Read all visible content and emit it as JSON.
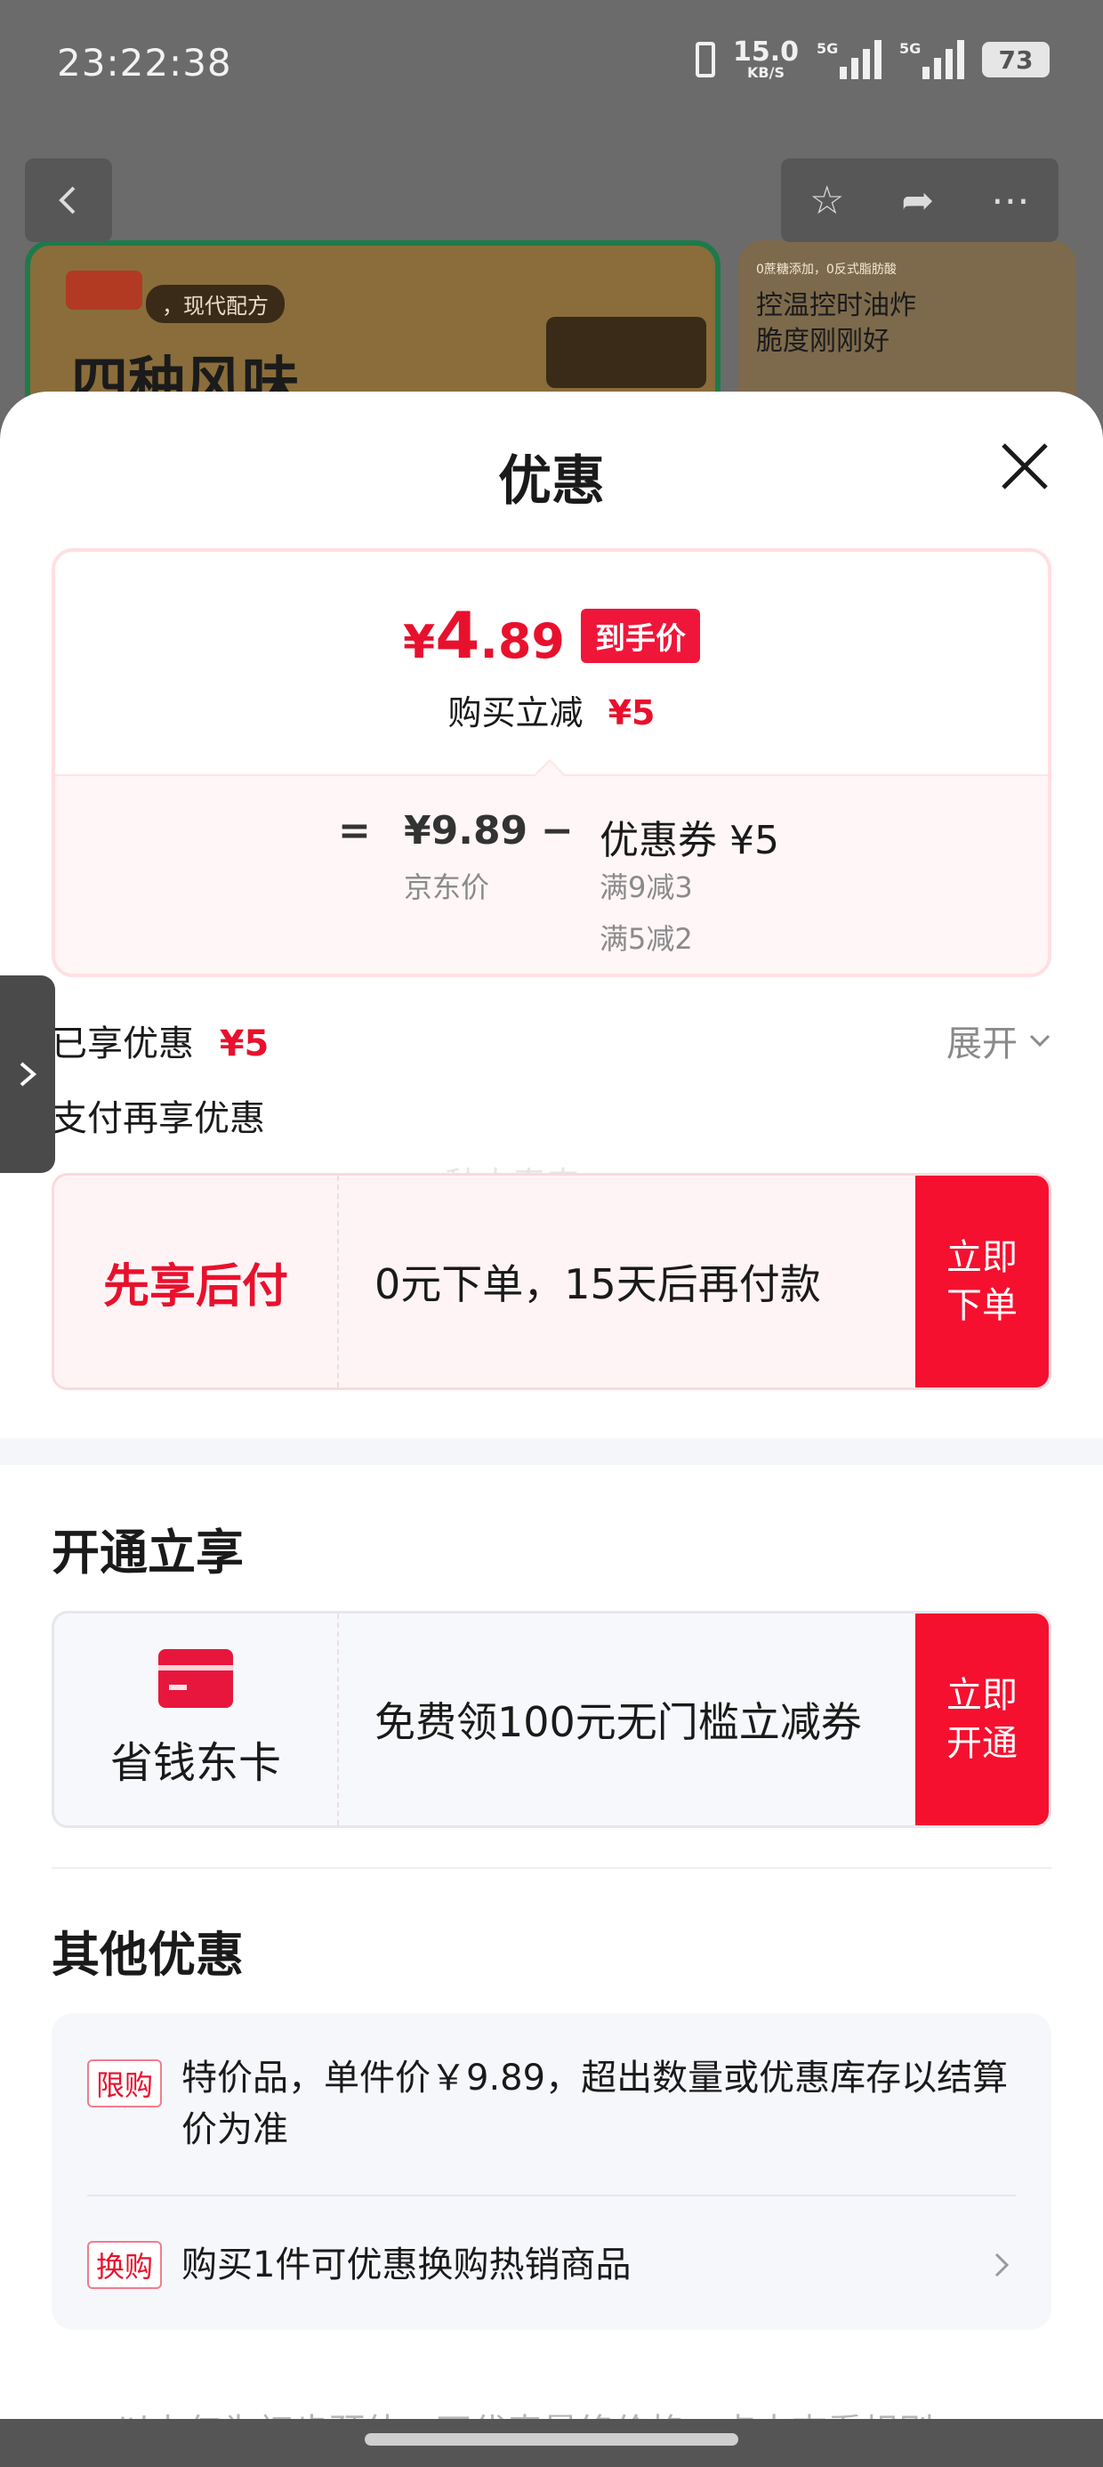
{
  "status_bar": {
    "time": "23:22:38",
    "net_speed": "15.0",
    "net_unit": "KB/S",
    "signal_1_label": "5G",
    "signal_2_label": "5G",
    "battery": "73"
  },
  "background": {
    "banner1_tag": "，现代配方",
    "banner1_headline": "四种风味",
    "banner2_line1": "控温控时油炸",
    "banner2_line2": "脆度刚刚好",
    "banner2_small": "0蔗糖添加，0反式脂肪酸"
  },
  "sheet": {
    "title": "优惠",
    "price_card": {
      "currency": "¥",
      "final_int": "4",
      "final_dec": ".89",
      "badge": "到手价",
      "reduce_label": "购买立减",
      "reduce_amount": "¥5",
      "equals": "=",
      "jd_price": "¥9.89",
      "jd_price_label": "京东价",
      "minus": "−",
      "coupon": "优惠券 ¥5",
      "coupon_rule_1": "满9减3",
      "coupon_rule_2": "满5减2"
    },
    "enjoyed_label": "已享优惠",
    "enjoyed_amount": "¥5",
    "expand_label": "展开",
    "pay_more_label": "支付再享优惠",
    "watermark": "秋去春来",
    "pay_later": {
      "title": "先享后付",
      "desc": "0元下单，15天后再付款",
      "btn_line1": "立即",
      "btn_line2": "下单"
    },
    "open_section_title": "开通立享",
    "member": {
      "name": "省钱东卡",
      "desc": "免费领100元无门槛立减券",
      "btn_line1": "立即",
      "btn_line2": "开通"
    },
    "other_section_title": "其他优惠",
    "other": [
      {
        "tag": "限购",
        "text": "特价品，单件价￥9.89，超出数量或优惠库存以结算价为准"
      },
      {
        "tag": "换购",
        "text": "购买1件可优惠换购热销商品"
      }
    ],
    "footer_peek": "以上仅为初步预估，不代表最终价格，点击查看规则"
  },
  "colors": {
    "accent_red": "#e8112d",
    "button_red": "#f5102f"
  }
}
